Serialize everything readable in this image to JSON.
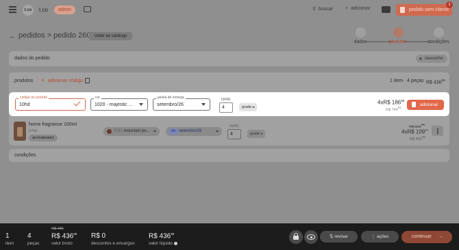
{
  "topbar": {
    "logo": "t.co",
    "store": "t.co",
    "role_badge": "admin",
    "search_label": "buscar",
    "add_label": "adicionar",
    "order_button": "pedido sem cliente",
    "notification_count": "1"
  },
  "header": {
    "breadcrumb": "pedidos > pedido 2604",
    "back_to_catalog": "voltar ao catálogo",
    "steps": [
      {
        "label": "dados",
        "icon": "person-icon"
      },
      {
        "label": "produtos",
        "icon": "tag-icon"
      },
      {
        "label": "condições",
        "icon": "dollar-icon"
      }
    ],
    "active_step": "produtos"
  },
  "order_data": {
    "title": "dados do pedido",
    "status": "rascunho"
  },
  "products": {
    "title": "produtos",
    "add_code": "adicionar código",
    "summary_items": "1 item",
    "summary_pieces": "4 peças",
    "summary_total": "R$ 436",
    "summary_total_cents": "98"
  },
  "entry": {
    "code_label": "código do produto",
    "code_value": "10hd",
    "color_label": "cor",
    "color_value": "1020 - majestic ...",
    "delivery_label": "janela de entrega",
    "delivery_value": "setembro/26",
    "size_label": "190ML",
    "qty": "4",
    "grid_label": "grade",
    "unit_price": "4xR$ 186",
    "unit_price_cents": "96",
    "total_price": "R$ 744",
    "total_price_cents": "84",
    "add_button": "adicionar"
  },
  "line_item": {
    "name": "home fragrance 100ml",
    "sku": "07hd",
    "tag": "aromatizador",
    "color_code": "1011",
    "color_name": "mountain pe...",
    "delivery_prefix": "pm",
    "delivery": "setembro/26",
    "size_label": "100ML",
    "qty": "4",
    "grid_label": "grade",
    "old_price": "R$ 121",
    "old_price_cents": "20",
    "unit_price": "4xR$ 109",
    "unit_price_cents": "17",
    "total": "R$ 436",
    "total_cents": "68"
  },
  "conditions": {
    "title": "condições"
  },
  "footer": {
    "items_value": "1",
    "items_label": "item",
    "pieces_value": "4",
    "pieces_label": "peças",
    "gross_old": "R$ 485",
    "gross_value": "R$ 436",
    "gross_cents": "68",
    "gross_label": "valor bruto",
    "discounts_value": "R$ 0",
    "discounts_label": "descontos e encargos",
    "net_value": "R$ 436",
    "net_cents": "68",
    "net_label": "valor líquido",
    "review_button": "revisar",
    "actions_button": "ações",
    "continue_button": "continuar"
  },
  "colors": {
    "accent": "#e1684a",
    "overlay": "#8f8f8f",
    "footer_bg": "#1c1c1c"
  }
}
